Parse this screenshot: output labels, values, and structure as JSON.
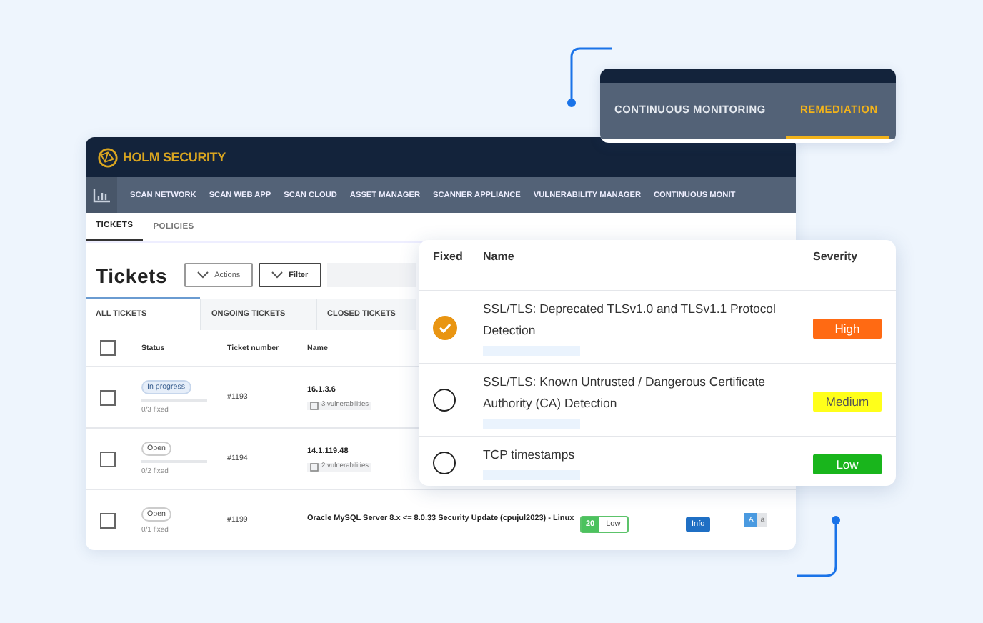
{
  "popup": {
    "tabs": [
      {
        "label": "CONTINUOUS MONITORING",
        "selected": false
      },
      {
        "label": "REMEDIATION",
        "selected": true
      }
    ]
  },
  "app": {
    "brand": "HOLM SECURITY",
    "nav": [
      "SCAN NETWORK",
      "SCAN WEB APP",
      "SCAN CLOUD",
      "ASSET MANAGER",
      "SCANNER APPLIANCE",
      "VULNERABILITY MANAGER",
      "CONTINUOUS MONIT"
    ],
    "subtabs": [
      {
        "label": "TICKETS",
        "selected": true
      },
      {
        "label": "POLICIES",
        "selected": false
      }
    ],
    "title": "Tickets",
    "buttons": [
      "Actions",
      "Filter"
    ],
    "ticket_tabs": [
      {
        "label": "ALL TICKETS",
        "selected": true
      },
      {
        "label": "ONGOING TICKETS",
        "selected": false
      },
      {
        "label": "CLOSED TICKETS",
        "selected": false
      }
    ],
    "select_all": {
      "checked": false
    },
    "columns": [
      "Status",
      "Ticket number",
      "Name"
    ],
    "rows": [
      {
        "checked": false,
        "status": "In progress",
        "kind": "progress",
        "level": 0,
        "fixed": "0/3 fixed",
        "number": "#1193",
        "name": "16.1.3.6",
        "vulns": "3 vulnerabilities"
      },
      {
        "checked": false,
        "status": "Open",
        "kind": "open",
        "level": 0,
        "fixed": "0/2 fixed",
        "number": "#1194",
        "name": "14.1.119.48",
        "vulns": "2 vulnerabilities"
      },
      {
        "checked": false,
        "status": "Open",
        "kind": "open",
        "fixed": "0/1 fixed",
        "number": "#1199",
        "name": "Oracle MySQL Server 8.x <= 8.0.33 Security Update (cpujul2023) - Linux",
        "score": "20",
        "risk": "Low",
        "info": "Info",
        "tag": "A",
        "tag_extra": "a"
      }
    ]
  },
  "findings": {
    "columns": [
      "Fixed",
      "Name",
      "Severity"
    ],
    "rows": [
      {
        "fixed": true,
        "name": "SSL/TLS: Deprecated TLSv1.0 and TLSv1.1 Protocol Detection",
        "severity": "High",
        "color": "#ff6a13"
      },
      {
        "fixed": false,
        "name": "SSL/TLS: Known Untrusted / Dangerous Certificate Authority (CA) Detection",
        "severity": "Medium",
        "color": "#ffff1a"
      },
      {
        "fixed": false,
        "name": "TCP timestamps",
        "severity": "Low",
        "color": "#19b51c"
      }
    ]
  }
}
